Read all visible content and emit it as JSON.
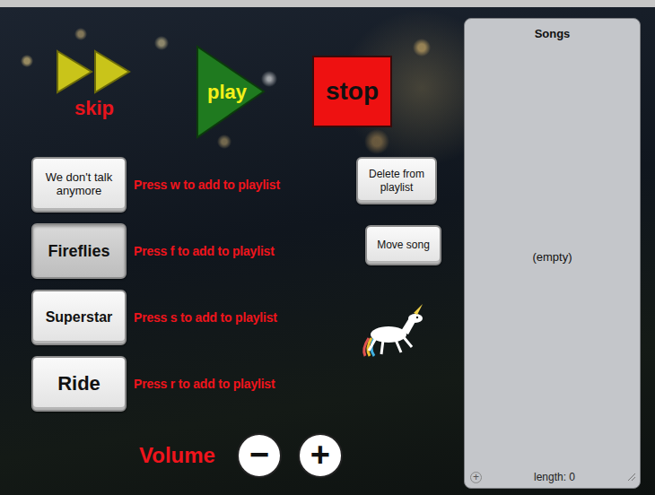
{
  "controls": {
    "skip": {
      "label": "skip"
    },
    "play": {
      "label": "play"
    },
    "stop": {
      "label": "stop"
    }
  },
  "songs": [
    {
      "title": "We don't talk anymore",
      "hint": "Press w to add to playlist",
      "highlighted": false
    },
    {
      "title": "Fireflies",
      "hint": "Press f to add to playlist",
      "highlighted": true
    },
    {
      "title": "Superstar",
      "hint": "Press s to add to playlist",
      "highlighted": false
    },
    {
      "title": "Ride",
      "hint": "Press r to add to playlist",
      "highlighted": false
    }
  ],
  "actions": {
    "delete": "Delete from playlist",
    "move": "Move song"
  },
  "volume": {
    "label": "Volume",
    "down": "−",
    "up": "+"
  },
  "playlist": {
    "title": "Songs",
    "items": [],
    "empty": "(empty)",
    "add": "+",
    "length": "length: 0"
  }
}
